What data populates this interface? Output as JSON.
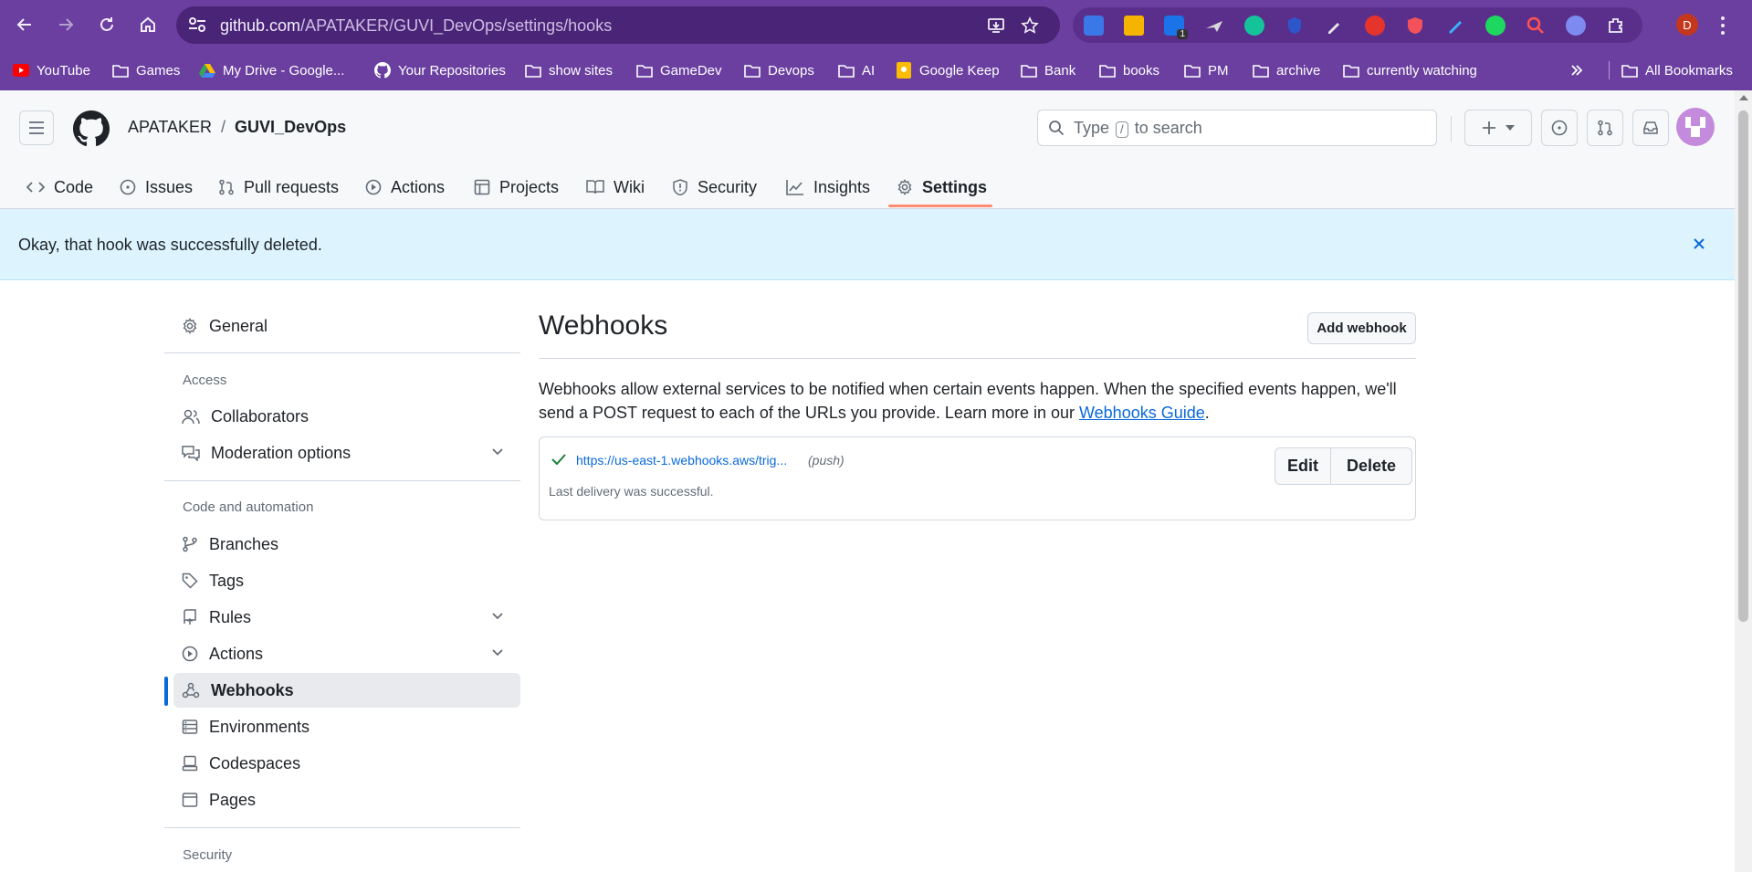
{
  "browser": {
    "url_host": "github.com",
    "url_path": "/APATAKER/GUVI_DevOps/settings/hooks",
    "profile_initial": "D",
    "bookmarks": [
      {
        "label": "YouTube",
        "icon": "youtube-icon"
      },
      {
        "label": "Games",
        "icon": "folder-icon"
      },
      {
        "label": "My Drive - Google...",
        "icon": "google-drive-icon"
      },
      {
        "label": "Your Repositories",
        "icon": "github-icon"
      },
      {
        "label": "show sites",
        "icon": "folder-icon"
      },
      {
        "label": "GameDev",
        "icon": "folder-icon"
      },
      {
        "label": "Devops",
        "icon": "folder-icon"
      },
      {
        "label": "AI",
        "icon": "folder-icon"
      },
      {
        "label": "Google Keep",
        "icon": "google-keep-icon"
      },
      {
        "label": "Bank",
        "icon": "folder-icon"
      },
      {
        "label": "books",
        "icon": "folder-icon"
      },
      {
        "label": "PM",
        "icon": "folder-icon"
      },
      {
        "label": "archive",
        "icon": "folder-icon"
      },
      {
        "label": "currently watching",
        "icon": "folder-icon"
      },
      {
        "label": "All Bookmarks",
        "icon": "folder-icon"
      }
    ],
    "extension_badge": "1"
  },
  "header": {
    "owner": "APATAKER",
    "separator": "/",
    "repo": "GUVI_DevOps",
    "search_pre": "Type",
    "search_key": "/",
    "search_post": "to search"
  },
  "tabs": [
    {
      "label": "Code",
      "icon": "code-icon"
    },
    {
      "label": "Issues",
      "icon": "issue-icon"
    },
    {
      "label": "Pull requests",
      "icon": "pull-request-icon"
    },
    {
      "label": "Actions",
      "icon": "play-icon"
    },
    {
      "label": "Projects",
      "icon": "table-icon"
    },
    {
      "label": "Wiki",
      "icon": "book-icon"
    },
    {
      "label": "Security",
      "icon": "shield-icon"
    },
    {
      "label": "Insights",
      "icon": "graph-icon"
    },
    {
      "label": "Settings",
      "icon": "gear-icon",
      "active": true
    }
  ],
  "flash": {
    "message": "Okay, that hook was successfully deleted."
  },
  "sidebar": {
    "general": "General",
    "access_heading": "Access",
    "collaborators": "Collaborators",
    "moderation": "Moderation options",
    "code_heading": "Code and automation",
    "branches": "Branches",
    "tags": "Tags",
    "rules": "Rules",
    "actions": "Actions",
    "webhooks": "Webhooks",
    "environments": "Environments",
    "codespaces": "Codespaces",
    "pages": "Pages",
    "security_heading": "Security"
  },
  "main": {
    "title": "Webhooks",
    "add_button": "Add webhook",
    "desc_text": "Webhooks allow external services to be notified when certain events happen. When the specified events happen, we'll send a POST request to each of the URLs you provide. Learn more in our ",
    "desc_link": "Webhooks Guide",
    "desc_end": ".",
    "hook": {
      "url": "https://us-east-1.webhooks.aws/trig...",
      "event": "(push)",
      "status": "Last delivery was successful.",
      "edit_label": "Edit",
      "delete_label": "Delete"
    }
  },
  "colors": {
    "browser_chrome": "#6b3fa0",
    "flash_bg": "#ddf4ff",
    "active_tab_underline": "#fd8c73",
    "link": "#0969da",
    "success": "#1a7f37"
  }
}
